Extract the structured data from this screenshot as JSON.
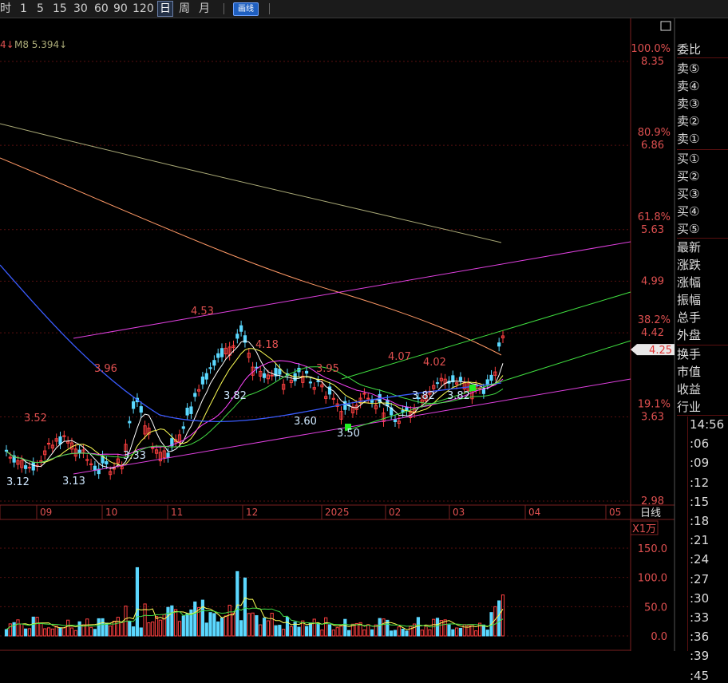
{
  "toolbar": {
    "periods": [
      "时",
      "1",
      "5",
      "15",
      "30",
      "60",
      "90",
      "120",
      "日",
      "周",
      "月"
    ],
    "selected": "日",
    "draw_label": "画线"
  },
  "ma_legend": {
    "partial": "4↓",
    "m8": "M8 5.394↓"
  },
  "price_axis": [
    {
      "pct": "100.0%",
      "price": "8.35"
    },
    {
      "pct": "80.9%",
      "price": "6.86"
    },
    {
      "pct": "61.8%",
      "price": "5.63"
    },
    {
      "pct": "",
      "price": "4.99"
    },
    {
      "pct": "38.2%",
      "price": "4.42"
    },
    {
      "pct": "19.1%",
      "price": "3.63"
    },
    {
      "pct": "",
      "price": "2.98"
    }
  ],
  "current_price": "4.25",
  "time_axis": [
    "09",
    "10",
    "11",
    "12",
    "2025",
    "02",
    "03",
    "04",
    "05"
  ],
  "period_label": "日线",
  "volume": {
    "unit": "X1万",
    "ticks": [
      "150.0",
      "100.0",
      "50.0",
      "0.0"
    ]
  },
  "annotations": [
    "3.52",
    "3.12",
    "3.13",
    "3.96",
    "3.33",
    "4.53",
    "4.18",
    "3.82",
    "3.95",
    "3.60",
    "3.50",
    "4.07",
    "4.02",
    "3.82",
    "3.82"
  ],
  "side_panel": {
    "header": "委比",
    "sells": [
      "卖⑤",
      "卖④",
      "卖③",
      "卖②",
      "卖①"
    ],
    "buys": [
      "买①",
      "买②",
      "买③",
      "买④",
      "买⑤"
    ],
    "stats": [
      "最新",
      "涨跌",
      "涨幅",
      "振幅",
      "总手",
      "外盘"
    ],
    "stats2": [
      "换手",
      "市值",
      "收益",
      "行业"
    ],
    "times": [
      "14:56",
      ":06",
      ":09",
      ":12",
      ":15",
      ":18",
      ":21",
      ":24",
      ":27",
      ":30",
      ":33",
      ":36",
      ":39",
      ":45"
    ]
  },
  "colors": {
    "up": "#ff4040",
    "down": "#5bd8ff",
    "ma_white": "#ffffff",
    "ma_yellow": "#ffff55",
    "ma_magenta": "#ff44ff",
    "ma_green": "#44dd44",
    "ma_blue": "#3a5cff",
    "ma_orange": "#ff9966",
    "ma_olive": "#aaaa77",
    "channel_magenta": "#e040e0",
    "channel_green": "#40e040"
  }
}
